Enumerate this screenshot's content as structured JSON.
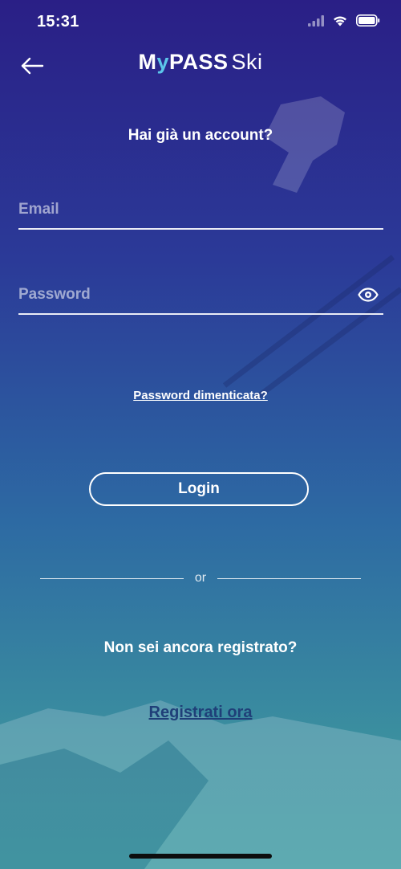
{
  "status_bar": {
    "time": "15:31",
    "icons": [
      "cellular-signal-icon",
      "wifi-icon",
      "battery-icon"
    ]
  },
  "header": {
    "back_icon": "arrow-left-icon",
    "logo": {
      "brand_part1": "M",
      "brand_accent": "y",
      "brand_part2": "PASS",
      "suffix": "Ski"
    }
  },
  "login": {
    "heading": "Hai già un account?",
    "email": {
      "placeholder": "Email",
      "value": ""
    },
    "password": {
      "placeholder": "Password",
      "value": "",
      "toggle_icon": "eye-icon"
    },
    "forgot_password": "Password dimenticata?",
    "login_button": "Login"
  },
  "divider_text": "or",
  "register": {
    "question": "Non sei ancora registrato?",
    "link": "Registrati ora"
  },
  "colors": {
    "background_top": "#2a1f86",
    "background_bottom": "#3a9aa0",
    "logo_accent": "#5cc6ea",
    "register_link": "#1f3f78",
    "text": "#ffffff"
  }
}
